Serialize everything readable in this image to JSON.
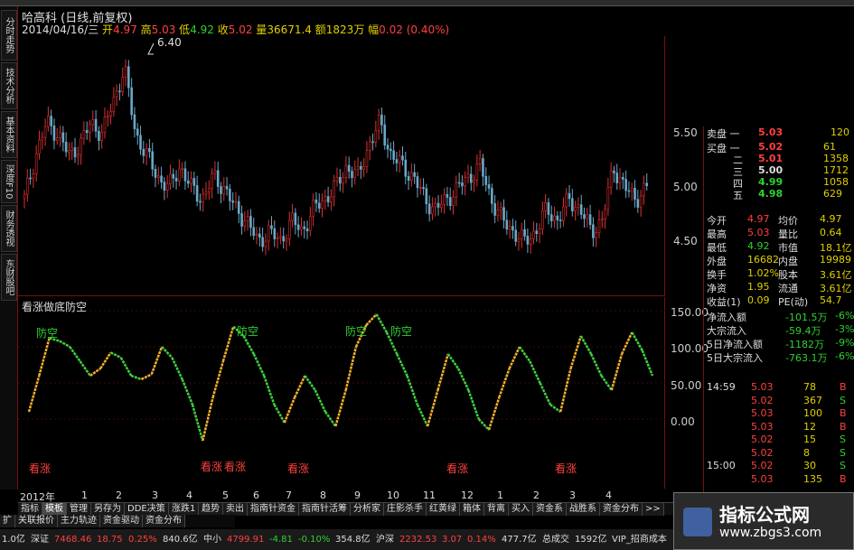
{
  "sidebar": {
    "tabs": [
      "分时走势",
      "技术分析",
      "基本资料",
      "深度F10",
      "财务透视",
      "东财股吧"
    ]
  },
  "header": {
    "stock_title": "哈高科 (日线,前复权)",
    "date": "2014/04/16/三",
    "open_label": "开",
    "open_val": "4.97",
    "high_label": "高",
    "high_val": "5.03",
    "low_label": "低",
    "low_val": "4.92",
    "close_label": "收",
    "close_val": "5.02",
    "vol_label": "量",
    "vol_val": "36671.4",
    "amt_label": "额",
    "amt_val": "1823万",
    "chg_label": "幅",
    "chg_val": "0.02 (0.40%)"
  },
  "main_chart": {
    "peak_label": "6.40",
    "y_labels": [
      "5.50",
      "5.00",
      "4.50"
    ],
    "colors": {
      "up": "#e03030",
      "down": "#6aa8c8"
    }
  },
  "indicator": {
    "title": "看涨做底防空",
    "y_labels": [
      "150.00",
      "100.00",
      "50.00",
      "0.00"
    ],
    "signals": [
      "防空",
      "防空",
      "防空",
      "防空",
      "看涨",
      "看涨",
      "看涨",
      "看涨",
      "看涨",
      "看涨"
    ],
    "colors": {
      "rise": "#f0b030",
      "fall": "#40d040"
    },
    "chart_data": {
      "type": "line",
      "series": [
        {
          "values": [
            10,
            60,
            112,
            108,
            100,
            80,
            60,
            70,
            92,
            85,
            60,
            55,
            62,
            100,
            85,
            55,
            20,
            -30,
            30,
            80,
            128,
            115,
            90,
            60,
            20,
            -5,
            30,
            60,
            40,
            10,
            -10,
            40,
            100,
            130,
            145,
            120,
            90,
            60,
            20,
            -10,
            40,
            90,
            70,
            40,
            0,
            -15,
            30,
            70,
            100,
            80,
            50,
            20,
            10,
            70,
            115,
            90,
            60,
            40,
            90,
            120,
            95,
            60
          ]
        }
      ]
    }
  },
  "right_panel": {
    "ask_label": "卖盘 一",
    "ask_price": "5.03",
    "ask_vol": "120",
    "bids": [
      {
        "label": "买盘 一",
        "price": "5.02",
        "vol": "61"
      },
      {
        "label": "二",
        "price": "5.01",
        "vol": "1358"
      },
      {
        "label": "三",
        "price": "5.00",
        "vol": "1712"
      },
      {
        "label": "四",
        "price": "4.99",
        "vol": "1058"
      },
      {
        "label": "五",
        "price": "4.98",
        "vol": "629"
      }
    ],
    "stats": [
      {
        "l1": "今开",
        "v1": "4.97",
        "l2": "均价",
        "v2": "4.97"
      },
      {
        "l1": "最高",
        "v1": "5.03",
        "l2": "量比",
        "v2": "0.64"
      },
      {
        "l1": "最低",
        "v1": "4.92",
        "l2": "市值",
        "v2": "18.1亿"
      },
      {
        "l1": "外盘",
        "v1": "16682",
        "l2": "内盘",
        "v2": "19989"
      },
      {
        "l1": "换手",
        "v1": "1.02%",
        "l2": "股本",
        "v2": "3.61亿"
      },
      {
        "l1": "净资",
        "v1": "1.95",
        "l2": "流通",
        "v2": "3.61亿"
      },
      {
        "l1": "收益(1)",
        "v1": "0.09",
        "l2": "PE(动)",
        "v2": "54.7"
      }
    ],
    "flows": [
      {
        "label": "净流入额",
        "val": "-101.5万",
        "pct": "-6%"
      },
      {
        "label": "大宗流入",
        "val": "-59.4万",
        "pct": "-3%"
      },
      {
        "label": "5日净流入额",
        "val": "-1182万",
        "pct": "-9%"
      },
      {
        "label": "5日大宗流入",
        "val": "-763.1万",
        "pct": "-6%"
      }
    ],
    "ticks": [
      {
        "time": "14:59",
        "price": "5.03",
        "vol": "78",
        "side": "B"
      },
      {
        "time": "",
        "price": "5.02",
        "vol": "367",
        "side": "S"
      },
      {
        "time": "",
        "price": "5.03",
        "vol": "100",
        "side": "B"
      },
      {
        "time": "",
        "price": "5.03",
        "vol": "12",
        "side": "B"
      },
      {
        "time": "",
        "price": "5.02",
        "vol": "15",
        "side": "S"
      },
      {
        "time": "",
        "price": "5.02",
        "vol": "8",
        "side": "S"
      },
      {
        "time": "15:00",
        "price": "5.02",
        "vol": "30",
        "side": "S"
      },
      {
        "time": "",
        "price": "5.03",
        "vol": "135",
        "side": "B"
      }
    ]
  },
  "date_axis": [
    "2012年",
    "1",
    "2",
    "3",
    "4",
    "5",
    "6",
    "7",
    "8",
    "9",
    "10",
    "11",
    "12",
    "1",
    "2",
    "3",
    "4"
  ],
  "bottom_tabs": [
    "指标",
    "模板",
    "管理",
    "另存为",
    "DDE决策",
    "涨跌1",
    "趋势",
    "卖出",
    "指南针资金",
    "指南针活筹",
    "分析家",
    "庄影杀手",
    "红黄绿",
    "箱体",
    "背离",
    "买入",
    "资金系",
    "战胜系",
    "资金分布",
    ">>"
  ],
  "bottom_tabs2": [
    "扩",
    "关联报价",
    "主力轨迹",
    "资金驱动",
    "资金分布"
  ],
  "status": [
    {
      "t": "1.0亿",
      "c": "w"
    },
    {
      "t": "深证",
      "c": "w"
    },
    {
      "t": "7468.46",
      "c": "r"
    },
    {
      "t": "18.75",
      "c": "r"
    },
    {
      "t": "0.25%",
      "c": "r"
    },
    {
      "t": "840.6亿",
      "c": "w"
    },
    {
      "t": "中小",
      "c": "w"
    },
    {
      "t": "4799.91",
      "c": "r"
    },
    {
      "t": "-4.81",
      "c": "g"
    },
    {
      "t": "-0.10%",
      "c": "g"
    },
    {
      "t": "354.8亿",
      "c": "w"
    },
    {
      "t": "沪深",
      "c": "w"
    },
    {
      "t": "2232.53",
      "c": "r"
    },
    {
      "t": "3.07",
      "c": "r"
    },
    {
      "t": "0.14%",
      "c": "r"
    },
    {
      "t": "477.7亿",
      "c": "w"
    },
    {
      "t": "总成交",
      "c": "w"
    },
    {
      "t": "1592亿",
      "c": "w"
    },
    {
      "t": "VIP_招商成本",
      "c": "w"
    }
  ],
  "watermark": {
    "title": "指标公式网",
    "url": "www.zbgs3.com"
  }
}
